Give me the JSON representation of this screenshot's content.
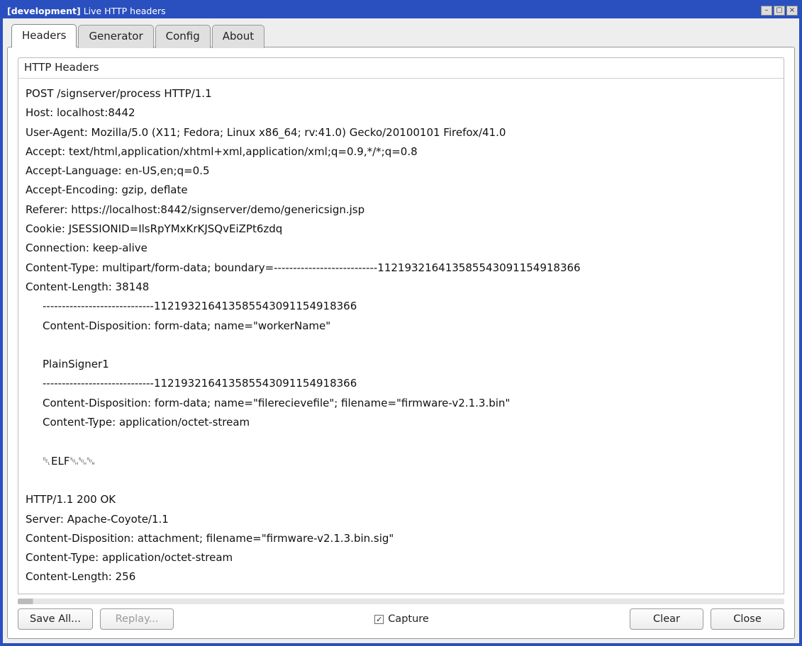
{
  "titlebar": {
    "prefix": "[development]",
    "title": "Live HTTP headers"
  },
  "tabs": [
    {
      "label": "Headers",
      "active": true
    },
    {
      "label": "Generator",
      "active": false
    },
    {
      "label": "Config",
      "active": false
    },
    {
      "label": "About",
      "active": false
    }
  ],
  "section_title": "HTTP Headers",
  "headers_block": {
    "request": [
      "POST /signserver/process HTTP/1.1",
      "Host: localhost:8442",
      "User-Agent: Mozilla/5.0 (X11; Fedora; Linux x86_64; rv:41.0) Gecko/20100101 Firefox/41.0",
      "Accept: text/html,application/xhtml+xml,application/xml;q=0.9,*/*;q=0.8",
      "Accept-Language: en-US,en;q=0.5",
      "Accept-Encoding: gzip, deflate",
      "Referer: https://localhost:8442/signserver/demo/genericsign.jsp",
      "Cookie: JSESSIONID=IlsRpYMxKrKJSQvEiZPt6zdq",
      "Connection: keep-alive",
      "Content-Type: multipart/form-data; boundary=---------------------------11219321641358554309115491­8366",
      "Content-Length: 38148"
    ],
    "body_parts": [
      "-----------------------------112193216413585543091154918366",
      "Content-Disposition: form-data; name=\"workerName\"",
      "",
      "PlainSigner1",
      "-----------------------------112193216413585543091154918366",
      "Content-Disposition: form-data; name=\"filerecievefile\"; filename=\"firmware-v2.1.3.bin\"",
      "Content-Type: application/octet-stream",
      "",
      "␡ELF␁␁␁"
    ],
    "response": [
      "HTTP/1.1 200 OK",
      "Server: Apache-Coyote/1.1",
      "Content-Disposition: attachment; filename=\"firmware-v2.1.3.bin.sig\"",
      "Content-Type: application/octet-stream",
      "Content-Length: 256"
    ]
  },
  "buttons": {
    "save_all": "Save All...",
    "replay": "Replay...",
    "capture": "Capture",
    "clear": "Clear",
    "close": "Close"
  },
  "capture_checked": true
}
